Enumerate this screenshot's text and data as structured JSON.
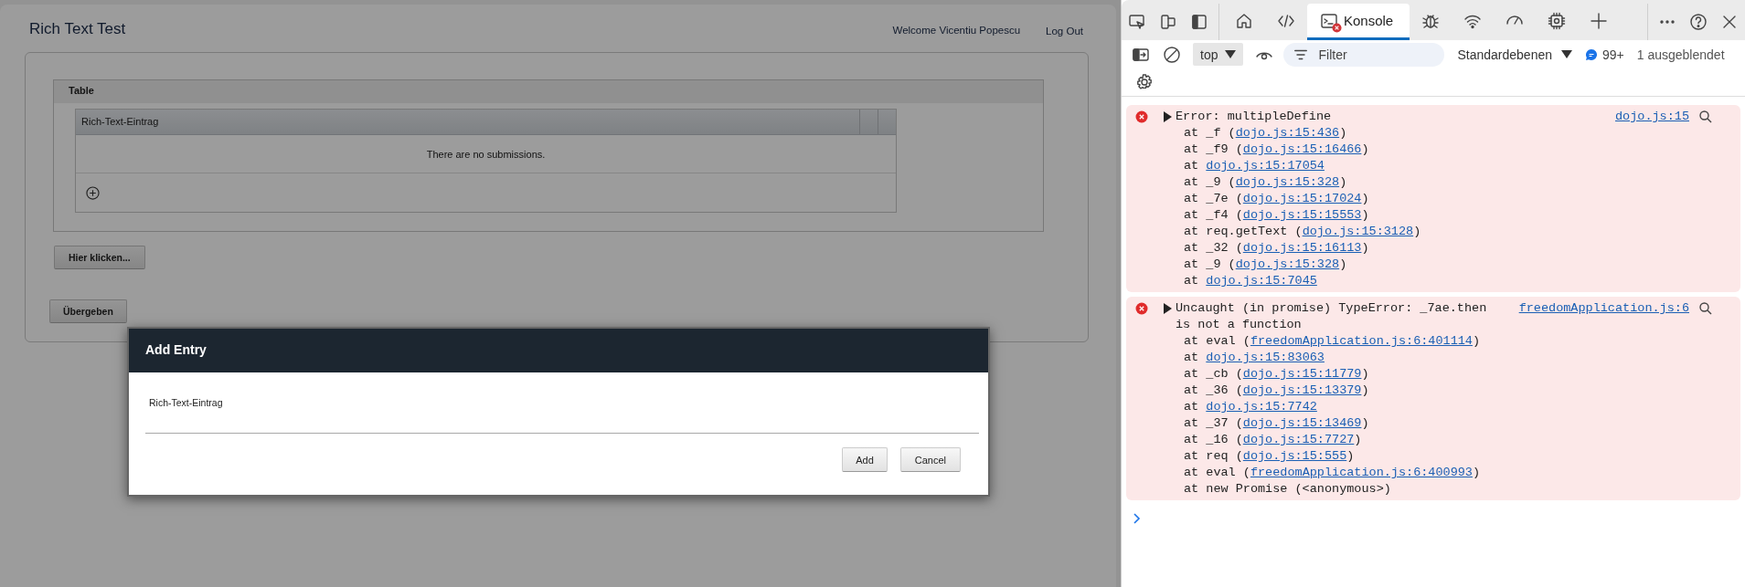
{
  "app": {
    "title": "Rich Text Test",
    "welcome": "Welcome Vicentiu Popescu",
    "logout": "Log Out"
  },
  "table_panel": {
    "title": "Table",
    "columns": [
      "Rich-Text-Eintrag"
    ],
    "empty_message": "There are no submissions."
  },
  "buttons": [
    "Hier klicken...",
    "Übergeben"
  ],
  "dialog": {
    "title": "Add Entry",
    "field_label": "Rich-Text-Eintrag",
    "buttons": [
      "Add",
      "Cancel"
    ]
  },
  "devtools": {
    "tabs": [
      {
        "kind": "welcome",
        "selected": false
      },
      {
        "kind": "elements",
        "selected": false
      },
      {
        "kind": "console",
        "label": "Konsole",
        "selected": true,
        "error_badge": true
      },
      {
        "kind": "sources",
        "selected": false
      },
      {
        "kind": "network",
        "selected": false
      },
      {
        "kind": "performance",
        "selected": false
      },
      {
        "kind": "memory",
        "selected": false
      },
      {
        "kind": "add",
        "selected": false
      }
    ],
    "context": "top",
    "filter": {
      "placeholder": "Filter"
    },
    "levels": "Standardebenen",
    "message_count": "99+",
    "hidden": "1 ausgeblendet",
    "messages": [
      {
        "kind": "error",
        "text": "Error: multipleDefine",
        "source": "dojo.js:15",
        "stack": [
          {
            "text": "at _f (",
            "link": "dojo.js:15:436",
            "after": ")"
          },
          {
            "text": "at _f9 (",
            "link": "dojo.js:15:16466",
            "after": ")"
          },
          {
            "text": "at ",
            "link": "dojo.js:15:17054"
          },
          {
            "text": "at _9 (",
            "link": "dojo.js:15:328",
            "after": ")"
          },
          {
            "text": "at _7e (",
            "link": "dojo.js:15:17024",
            "after": ")"
          },
          {
            "text": "at _f4 (",
            "link": "dojo.js:15:15553",
            "after": ")"
          },
          {
            "text": "at req.getText (",
            "link": "dojo.js:15:3128",
            "after": ")"
          },
          {
            "text": "at _32 (",
            "link": "dojo.js:15:16113",
            "after": ")"
          },
          {
            "text": "at _9 (",
            "link": "dojo.js:15:328",
            "after": ")"
          },
          {
            "text": "at ",
            "link": "dojo.js:15:7045"
          }
        ]
      },
      {
        "kind": "error",
        "text": "Uncaught (in promise) TypeError: _7ae.then is not a function",
        "source": "freedomApplication.js:6",
        "stack": [
          {
            "text": "at eval (",
            "link": "freedomApplication.js:6:401114",
            "after": ")"
          },
          {
            "text": "at ",
            "link": "dojo.js:15:83063"
          },
          {
            "text": "at _cb (",
            "link": "dojo.js:15:11779",
            "after": ")"
          },
          {
            "text": "at _36 (",
            "link": "dojo.js:15:13379",
            "after": ")"
          },
          {
            "text": "at ",
            "link": "dojo.js:15:7742"
          },
          {
            "text": "at _37 (",
            "link": "dojo.js:15:13469",
            "after": ")"
          },
          {
            "text": "at _16 (",
            "link": "dojo.js:15:7727",
            "after": ")"
          },
          {
            "text": "at req (",
            "link": "dojo.js:15:555",
            "after": ")"
          },
          {
            "text": "at eval (",
            "link": "freedomApplication.js:6:400993",
            "after": ")"
          },
          {
            "text": "at new Promise (<anonymous>)"
          }
        ]
      }
    ]
  }
}
